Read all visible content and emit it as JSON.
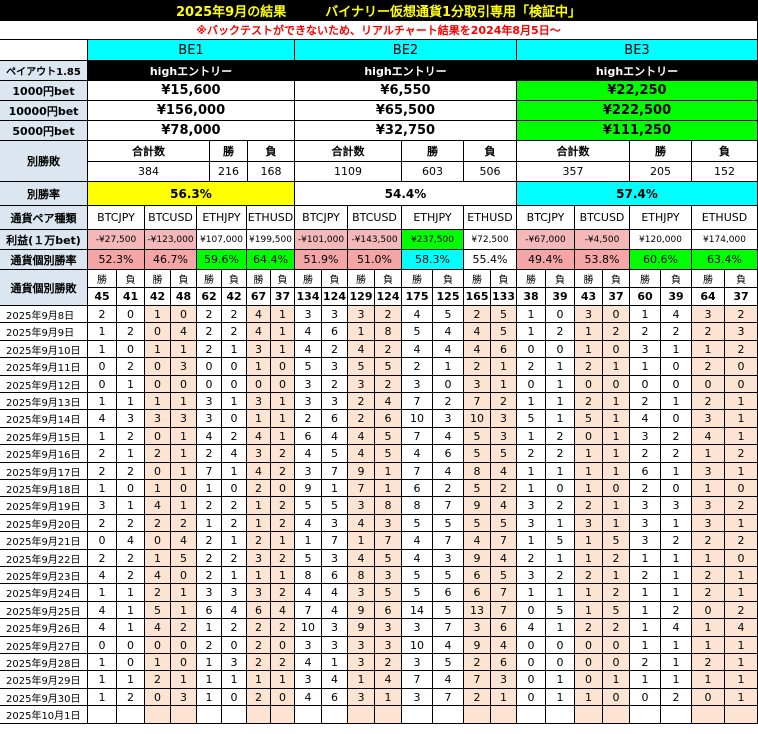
{
  "header": {
    "title": "2025年9月の結果　　　バイナリー仮想通貨1分取引専用「検証中」",
    "notice": "※バックテストができないため、リアルチャート結果を2024年8月5日～"
  },
  "be_headers": [
    "BE1",
    "BE2",
    "BE3"
  ],
  "rows_summary": {
    "payout_label": "ペイアウト1.85",
    "entry_labels": [
      "highエントリー",
      "highエントリー",
      "highエントリー"
    ],
    "bet_rows": [
      {
        "label": "1000円bet",
        "values": [
          "¥15,600",
          "¥6,550",
          "¥22,250"
        ]
      },
      {
        "label": "10000円bet",
        "values": [
          "¥156,000",
          "¥65,500",
          "¥222,500"
        ]
      },
      {
        "label": "5000円bet",
        "values": [
          "¥78,000",
          "¥32,750",
          "¥111,250"
        ]
      }
    ],
    "winloss_label": "別勝敗",
    "winloss_headers": [
      "合計数",
      "勝",
      "負"
    ],
    "winloss_values": [
      [
        "384",
        "216",
        "168"
      ],
      [
        "1109",
        "603",
        "506"
      ],
      [
        "357",
        "205",
        "152"
      ]
    ],
    "winrate_label": "別勝率",
    "winrates": [
      "56.3%",
      "54.4%",
      "57.4%"
    ]
  },
  "pairs": {
    "label": "通貨ペア種類",
    "names": [
      "BTCJPY",
      "BTCUSD",
      "ETHJPY",
      "ETHUSD",
      "BTCJPY",
      "BTCUSD",
      "ETHJPY",
      "ETHUSD",
      "BTCJPY",
      "BTCUSD",
      "ETHJPY",
      "ETHUSD"
    ],
    "profit_label": "利益(１万bet)",
    "profits": [
      "-¥27,500",
      "-¥123,000",
      "¥107,000",
      "¥199,500",
      "-¥101,000",
      "-¥143,500",
      "¥237,500",
      "¥72,500",
      "-¥67,000",
      "-¥4,500",
      "¥120,000",
      "¥174,000"
    ],
    "rate_label": "通貨個別勝率",
    "rates": [
      "52.3%",
      "46.7%",
      "59.6%",
      "64.4%",
      "51.9%",
      "51.0%",
      "58.3%",
      "55.4%",
      "49.4%",
      "53.8%",
      "60.6%",
      "63.4%"
    ],
    "winloss_label": "通貨個別勝敗",
    "win_label": "勝",
    "loss_label": "負",
    "totals": [
      "45",
      "41",
      "42",
      "48",
      "62",
      "42",
      "67",
      "37",
      "134",
      "124",
      "129",
      "124",
      "175",
      "125",
      "165",
      "133",
      "38",
      "39",
      "43",
      "37",
      "60",
      "39",
      "64",
      "37"
    ]
  },
  "daily": [
    {
      "date": "2025年9月8日",
      "v": [
        "2",
        "0",
        "1",
        "0",
        "2",
        "2",
        "4",
        "1",
        "3",
        "3",
        "3",
        "2",
        "4",
        "5",
        "2",
        "5",
        "1",
        "0",
        "3",
        "0",
        "1",
        "4",
        "3",
        "2"
      ]
    },
    {
      "date": "2025年9月9日",
      "v": [
        "1",
        "2",
        "0",
        "4",
        "2",
        "2",
        "4",
        "1",
        "4",
        "6",
        "1",
        "8",
        "5",
        "4",
        "4",
        "5",
        "1",
        "2",
        "1",
        "2",
        "2",
        "2",
        "2",
        "3"
      ]
    },
    {
      "date": "2025年9月10日",
      "v": [
        "1",
        "0",
        "1",
        "1",
        "2",
        "1",
        "3",
        "1",
        "4",
        "2",
        "4",
        "2",
        "4",
        "4",
        "4",
        "6",
        "0",
        "0",
        "1",
        "0",
        "3",
        "1",
        "1",
        "2"
      ]
    },
    {
      "date": "2025年9月11日",
      "v": [
        "0",
        "2",
        "0",
        "3",
        "0",
        "0",
        "1",
        "0",
        "5",
        "3",
        "5",
        "5",
        "2",
        "1",
        "2",
        "1",
        "2",
        "1",
        "2",
        "1",
        "1",
        "0",
        "2",
        "0"
      ]
    },
    {
      "date": "2025年9月12日",
      "v": [
        "0",
        "1",
        "0",
        "0",
        "0",
        "0",
        "0",
        "0",
        "3",
        "2",
        "3",
        "2",
        "3",
        "0",
        "3",
        "1",
        "0",
        "1",
        "0",
        "0",
        "0",
        "0",
        "0",
        "0"
      ]
    },
    {
      "date": "2025年9月13日",
      "v": [
        "1",
        "1",
        "1",
        "1",
        "3",
        "1",
        "3",
        "1",
        "3",
        "3",
        "2",
        "4",
        "7",
        "2",
        "7",
        "2",
        "1",
        "1",
        "2",
        "1",
        "2",
        "1",
        "2",
        "1"
      ]
    },
    {
      "date": "2025年9月14日",
      "v": [
        "4",
        "3",
        "3",
        "3",
        "3",
        "0",
        "1",
        "1",
        "2",
        "6",
        "2",
        "6",
        "10",
        "3",
        "10",
        "3",
        "5",
        "1",
        "5",
        "1",
        "4",
        "0",
        "3",
        "1"
      ]
    },
    {
      "date": "2025年9月15日",
      "v": [
        "1",
        "2",
        "0",
        "1",
        "4",
        "2",
        "4",
        "1",
        "6",
        "4",
        "4",
        "5",
        "7",
        "4",
        "5",
        "3",
        "1",
        "2",
        "0",
        "1",
        "3",
        "2",
        "4",
        "1"
      ]
    },
    {
      "date": "2025年9月16日",
      "v": [
        "2",
        "1",
        "2",
        "1",
        "2",
        "4",
        "3",
        "2",
        "4",
        "5",
        "4",
        "5",
        "4",
        "6",
        "5",
        "5",
        "2",
        "2",
        "1",
        "1",
        "2",
        "2",
        "1",
        "2"
      ]
    },
    {
      "date": "2025年9月17日",
      "v": [
        "2",
        "2",
        "0",
        "1",
        "7",
        "1",
        "4",
        "2",
        "3",
        "7",
        "9",
        "1",
        "7",
        "4",
        "8",
        "4",
        "1",
        "1",
        "1",
        "1",
        "6",
        "1",
        "3",
        "1"
      ]
    },
    {
      "date": "2025年9月18日",
      "v": [
        "1",
        "0",
        "1",
        "0",
        "1",
        "0",
        "2",
        "0",
        "9",
        "1",
        "7",
        "1",
        "6",
        "2",
        "5",
        "2",
        "1",
        "0",
        "1",
        "0",
        "2",
        "0",
        "1",
        "0"
      ]
    },
    {
      "date": "2025年9月19日",
      "v": [
        "3",
        "1",
        "4",
        "1",
        "2",
        "2",
        "1",
        "2",
        "5",
        "5",
        "3",
        "8",
        "8",
        "7",
        "9",
        "4",
        "3",
        "2",
        "2",
        "1",
        "3",
        "3",
        "3",
        "2"
      ]
    },
    {
      "date": "2025年9月20日",
      "v": [
        "2",
        "2",
        "2",
        "2",
        "1",
        "2",
        "1",
        "2",
        "4",
        "3",
        "4",
        "3",
        "5",
        "5",
        "5",
        "5",
        "3",
        "1",
        "3",
        "1",
        "3",
        "1",
        "3",
        "1"
      ]
    },
    {
      "date": "2025年9月21日",
      "v": [
        "0",
        "4",
        "0",
        "4",
        "2",
        "1",
        "2",
        "1",
        "1",
        "7",
        "1",
        "7",
        "4",
        "7",
        "4",
        "7",
        "1",
        "5",
        "1",
        "5",
        "3",
        "2",
        "2",
        "2"
      ]
    },
    {
      "date": "2025年9月22日",
      "v": [
        "2",
        "2",
        "1",
        "5",
        "2",
        "2",
        "3",
        "2",
        "5",
        "3",
        "4",
        "5",
        "4",
        "3",
        "9",
        "4",
        "2",
        "1",
        "1",
        "2",
        "1",
        "1",
        "1",
        "0"
      ]
    },
    {
      "date": "2025年9月23日",
      "v": [
        "4",
        "2",
        "4",
        "0",
        "2",
        "1",
        "1",
        "1",
        "8",
        "6",
        "8",
        "3",
        "5",
        "5",
        "6",
        "5",
        "3",
        "2",
        "2",
        "1",
        "2",
        "1",
        "2",
        "1"
      ]
    },
    {
      "date": "2025年9月24日",
      "v": [
        "1",
        "1",
        "2",
        "1",
        "3",
        "3",
        "3",
        "2",
        "4",
        "4",
        "3",
        "5",
        "5",
        "6",
        "6",
        "7",
        "1",
        "1",
        "1",
        "2",
        "1",
        "1",
        "2",
        "1"
      ]
    },
    {
      "date": "2025年9月25日",
      "v": [
        "4",
        "1",
        "5",
        "1",
        "6",
        "4",
        "6",
        "4",
        "7",
        "4",
        "9",
        "6",
        "14",
        "5",
        "13",
        "7",
        "0",
        "5",
        "1",
        "5",
        "1",
        "2",
        "0",
        "2"
      ]
    },
    {
      "date": "2025年9月26日",
      "v": [
        "4",
        "1",
        "4",
        "2",
        "1",
        "2",
        "2",
        "2",
        "10",
        "3",
        "9",
        "3",
        "3",
        "7",
        "3",
        "6",
        "4",
        "1",
        "2",
        "2",
        "1",
        "4",
        "1",
        "4"
      ]
    },
    {
      "date": "2025年9月27日",
      "v": [
        "0",
        "0",
        "0",
        "0",
        "2",
        "0",
        "2",
        "0",
        "3",
        "3",
        "3",
        "3",
        "10",
        "4",
        "9",
        "4",
        "0",
        "0",
        "0",
        "0",
        "1",
        "1",
        "1",
        "1"
      ]
    },
    {
      "date": "2025年9月28日",
      "v": [
        "1",
        "0",
        "1",
        "0",
        "1",
        "3",
        "2",
        "2",
        "4",
        "1",
        "3",
        "2",
        "3",
        "5",
        "2",
        "6",
        "0",
        "0",
        "0",
        "0",
        "2",
        "1",
        "2",
        "1"
      ]
    },
    {
      "date": "2025年9月29日",
      "v": [
        "1",
        "1",
        "2",
        "1",
        "1",
        "1",
        "1",
        "1",
        "3",
        "4",
        "1",
        "4",
        "7",
        "4",
        "7",
        "3",
        "0",
        "1",
        "0",
        "1",
        "1",
        "1",
        "1",
        "1"
      ]
    },
    {
      "date": "2025年9月30日",
      "v": [
        "1",
        "2",
        "0",
        "3",
        "1",
        "0",
        "2",
        "0",
        "4",
        "6",
        "3",
        "1",
        "3",
        "7",
        "2",
        "1",
        "0",
        "1",
        "1",
        "0",
        "0",
        "2",
        "0",
        "1"
      ]
    },
    {
      "date": "2025年10月1日",
      "v": [
        "",
        "",
        "",
        "",
        "",
        "",
        "",
        "",
        "",
        "",
        "",
        "",
        "",
        "",
        "",
        "",
        "",
        "",
        "",
        "",
        "",
        "",
        "",
        ""
      ]
    }
  ],
  "colors": {
    "title_bg": "#000000",
    "title_fg": "#ffff00",
    "notice_fg": "#ff0000",
    "be_header_bg": "#00ffff",
    "label_bg": "#dce6f1",
    "entry_bg": "#000000",
    "entry_fg": "#ffffff",
    "be3_green": "#00ff00",
    "yellow": "#ffff00",
    "cyan": "#00ffff",
    "profit_neg": "#f4b8b8",
    "rate_neg": "#f4a6a6",
    "rate_pos": "#00ff00",
    "rate_cyan": "#00ffff",
    "peach": "#fde4d2"
  }
}
